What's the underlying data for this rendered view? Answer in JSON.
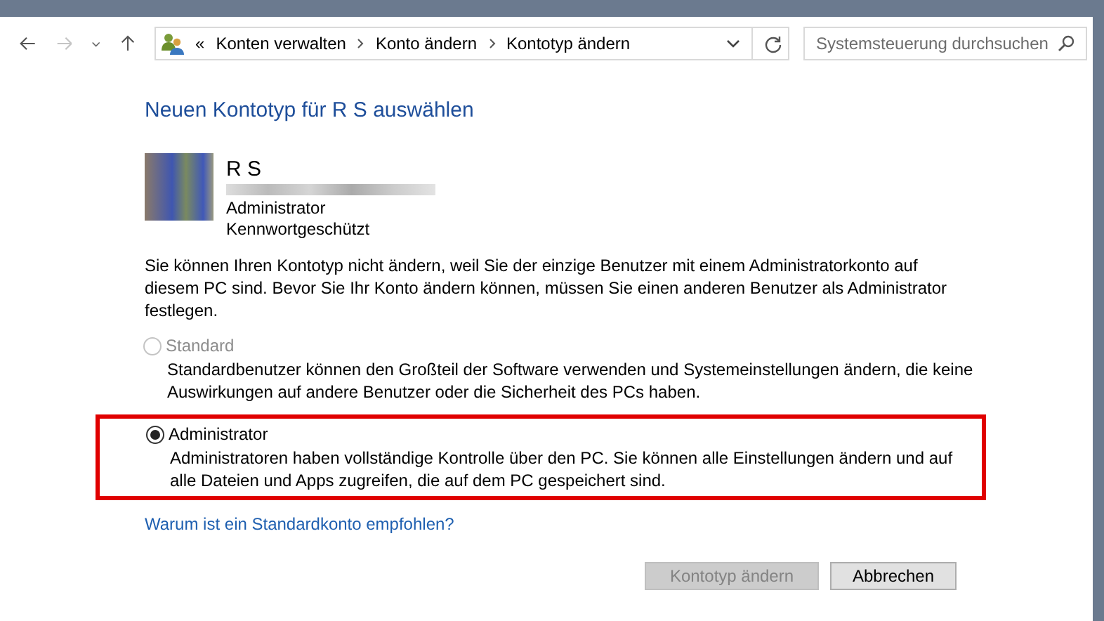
{
  "breadcrumbs": [
    "Konten verwalten",
    "Konto ändern",
    "Kontotyp ändern"
  ],
  "breadcrumb_overflow": "«",
  "search": {
    "placeholder": "Systemsteuerung durchsuchen"
  },
  "heading": "Neuen Kontotyp für R S auswählen",
  "account": {
    "name": "R S",
    "type": "Administrator",
    "status": "Kennwortgeschützt"
  },
  "notice": "Sie können Ihren Kontotyp nicht ändern, weil Sie der einzige Benutzer mit einem Administratorkonto auf diesem PC sind. Bevor Sie Ihr Konto ändern können, müssen Sie einen anderen Benutzer als Administrator festlegen.",
  "options": [
    {
      "label": "Standard",
      "description": "Standardbenutzer können den Großteil der Software verwenden und Systemeinstellungen ändern, die keine Auswirkungen auf andere Benutzer oder die Sicherheit des PCs haben.",
      "selected": false,
      "disabled": true,
      "highlighted": false
    },
    {
      "label": "Administrator",
      "description": "Administratoren haben vollständige Kontrolle über den PC. Sie können alle Einstellungen ändern und auf alle Dateien und Apps zugreifen, die auf dem PC gespeichert sind.",
      "selected": true,
      "disabled": false,
      "highlighted": true
    }
  ],
  "help_link": "Warum ist ein Standardkonto empfohlen?",
  "buttons": [
    {
      "label": "Kontotyp ändern",
      "disabled": true
    },
    {
      "label": "Abbrechen",
      "disabled": false
    }
  ]
}
